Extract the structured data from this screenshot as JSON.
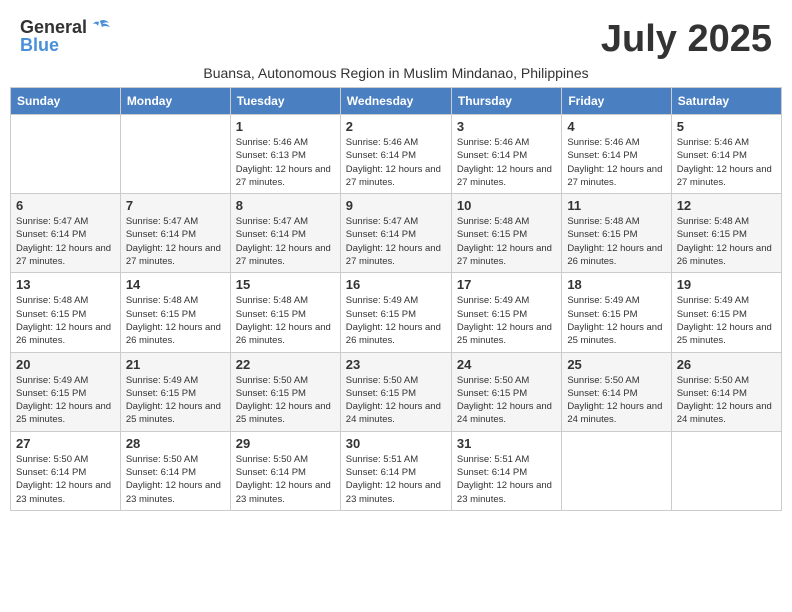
{
  "header": {
    "logo_general": "General",
    "logo_blue": "Blue",
    "month_title": "July 2025",
    "subtitle": "Buansa, Autonomous Region in Muslim Mindanao, Philippines"
  },
  "days_of_week": [
    "Sunday",
    "Monday",
    "Tuesday",
    "Wednesday",
    "Thursday",
    "Friday",
    "Saturday"
  ],
  "weeks": [
    [
      {
        "day": "",
        "info": ""
      },
      {
        "day": "",
        "info": ""
      },
      {
        "day": "1",
        "info": "Sunrise: 5:46 AM\nSunset: 6:13 PM\nDaylight: 12 hours and 27 minutes."
      },
      {
        "day": "2",
        "info": "Sunrise: 5:46 AM\nSunset: 6:14 PM\nDaylight: 12 hours and 27 minutes."
      },
      {
        "day": "3",
        "info": "Sunrise: 5:46 AM\nSunset: 6:14 PM\nDaylight: 12 hours and 27 minutes."
      },
      {
        "day": "4",
        "info": "Sunrise: 5:46 AM\nSunset: 6:14 PM\nDaylight: 12 hours and 27 minutes."
      },
      {
        "day": "5",
        "info": "Sunrise: 5:46 AM\nSunset: 6:14 PM\nDaylight: 12 hours and 27 minutes."
      }
    ],
    [
      {
        "day": "6",
        "info": "Sunrise: 5:47 AM\nSunset: 6:14 PM\nDaylight: 12 hours and 27 minutes."
      },
      {
        "day": "7",
        "info": "Sunrise: 5:47 AM\nSunset: 6:14 PM\nDaylight: 12 hours and 27 minutes."
      },
      {
        "day": "8",
        "info": "Sunrise: 5:47 AM\nSunset: 6:14 PM\nDaylight: 12 hours and 27 minutes."
      },
      {
        "day": "9",
        "info": "Sunrise: 5:47 AM\nSunset: 6:14 PM\nDaylight: 12 hours and 27 minutes."
      },
      {
        "day": "10",
        "info": "Sunrise: 5:48 AM\nSunset: 6:15 PM\nDaylight: 12 hours and 27 minutes."
      },
      {
        "day": "11",
        "info": "Sunrise: 5:48 AM\nSunset: 6:15 PM\nDaylight: 12 hours and 26 minutes."
      },
      {
        "day": "12",
        "info": "Sunrise: 5:48 AM\nSunset: 6:15 PM\nDaylight: 12 hours and 26 minutes."
      }
    ],
    [
      {
        "day": "13",
        "info": "Sunrise: 5:48 AM\nSunset: 6:15 PM\nDaylight: 12 hours and 26 minutes."
      },
      {
        "day": "14",
        "info": "Sunrise: 5:48 AM\nSunset: 6:15 PM\nDaylight: 12 hours and 26 minutes."
      },
      {
        "day": "15",
        "info": "Sunrise: 5:48 AM\nSunset: 6:15 PM\nDaylight: 12 hours and 26 minutes."
      },
      {
        "day": "16",
        "info": "Sunrise: 5:49 AM\nSunset: 6:15 PM\nDaylight: 12 hours and 26 minutes."
      },
      {
        "day": "17",
        "info": "Sunrise: 5:49 AM\nSunset: 6:15 PM\nDaylight: 12 hours and 25 minutes."
      },
      {
        "day": "18",
        "info": "Sunrise: 5:49 AM\nSunset: 6:15 PM\nDaylight: 12 hours and 25 minutes."
      },
      {
        "day": "19",
        "info": "Sunrise: 5:49 AM\nSunset: 6:15 PM\nDaylight: 12 hours and 25 minutes."
      }
    ],
    [
      {
        "day": "20",
        "info": "Sunrise: 5:49 AM\nSunset: 6:15 PM\nDaylight: 12 hours and 25 minutes."
      },
      {
        "day": "21",
        "info": "Sunrise: 5:49 AM\nSunset: 6:15 PM\nDaylight: 12 hours and 25 minutes."
      },
      {
        "day": "22",
        "info": "Sunrise: 5:50 AM\nSunset: 6:15 PM\nDaylight: 12 hours and 25 minutes."
      },
      {
        "day": "23",
        "info": "Sunrise: 5:50 AM\nSunset: 6:15 PM\nDaylight: 12 hours and 24 minutes."
      },
      {
        "day": "24",
        "info": "Sunrise: 5:50 AM\nSunset: 6:15 PM\nDaylight: 12 hours and 24 minutes."
      },
      {
        "day": "25",
        "info": "Sunrise: 5:50 AM\nSunset: 6:14 PM\nDaylight: 12 hours and 24 minutes."
      },
      {
        "day": "26",
        "info": "Sunrise: 5:50 AM\nSunset: 6:14 PM\nDaylight: 12 hours and 24 minutes."
      }
    ],
    [
      {
        "day": "27",
        "info": "Sunrise: 5:50 AM\nSunset: 6:14 PM\nDaylight: 12 hours and 23 minutes."
      },
      {
        "day": "28",
        "info": "Sunrise: 5:50 AM\nSunset: 6:14 PM\nDaylight: 12 hours and 23 minutes."
      },
      {
        "day": "29",
        "info": "Sunrise: 5:50 AM\nSunset: 6:14 PM\nDaylight: 12 hours and 23 minutes."
      },
      {
        "day": "30",
        "info": "Sunrise: 5:51 AM\nSunset: 6:14 PM\nDaylight: 12 hours and 23 minutes."
      },
      {
        "day": "31",
        "info": "Sunrise: 5:51 AM\nSunset: 6:14 PM\nDaylight: 12 hours and 23 minutes."
      },
      {
        "day": "",
        "info": ""
      },
      {
        "day": "",
        "info": ""
      }
    ]
  ]
}
